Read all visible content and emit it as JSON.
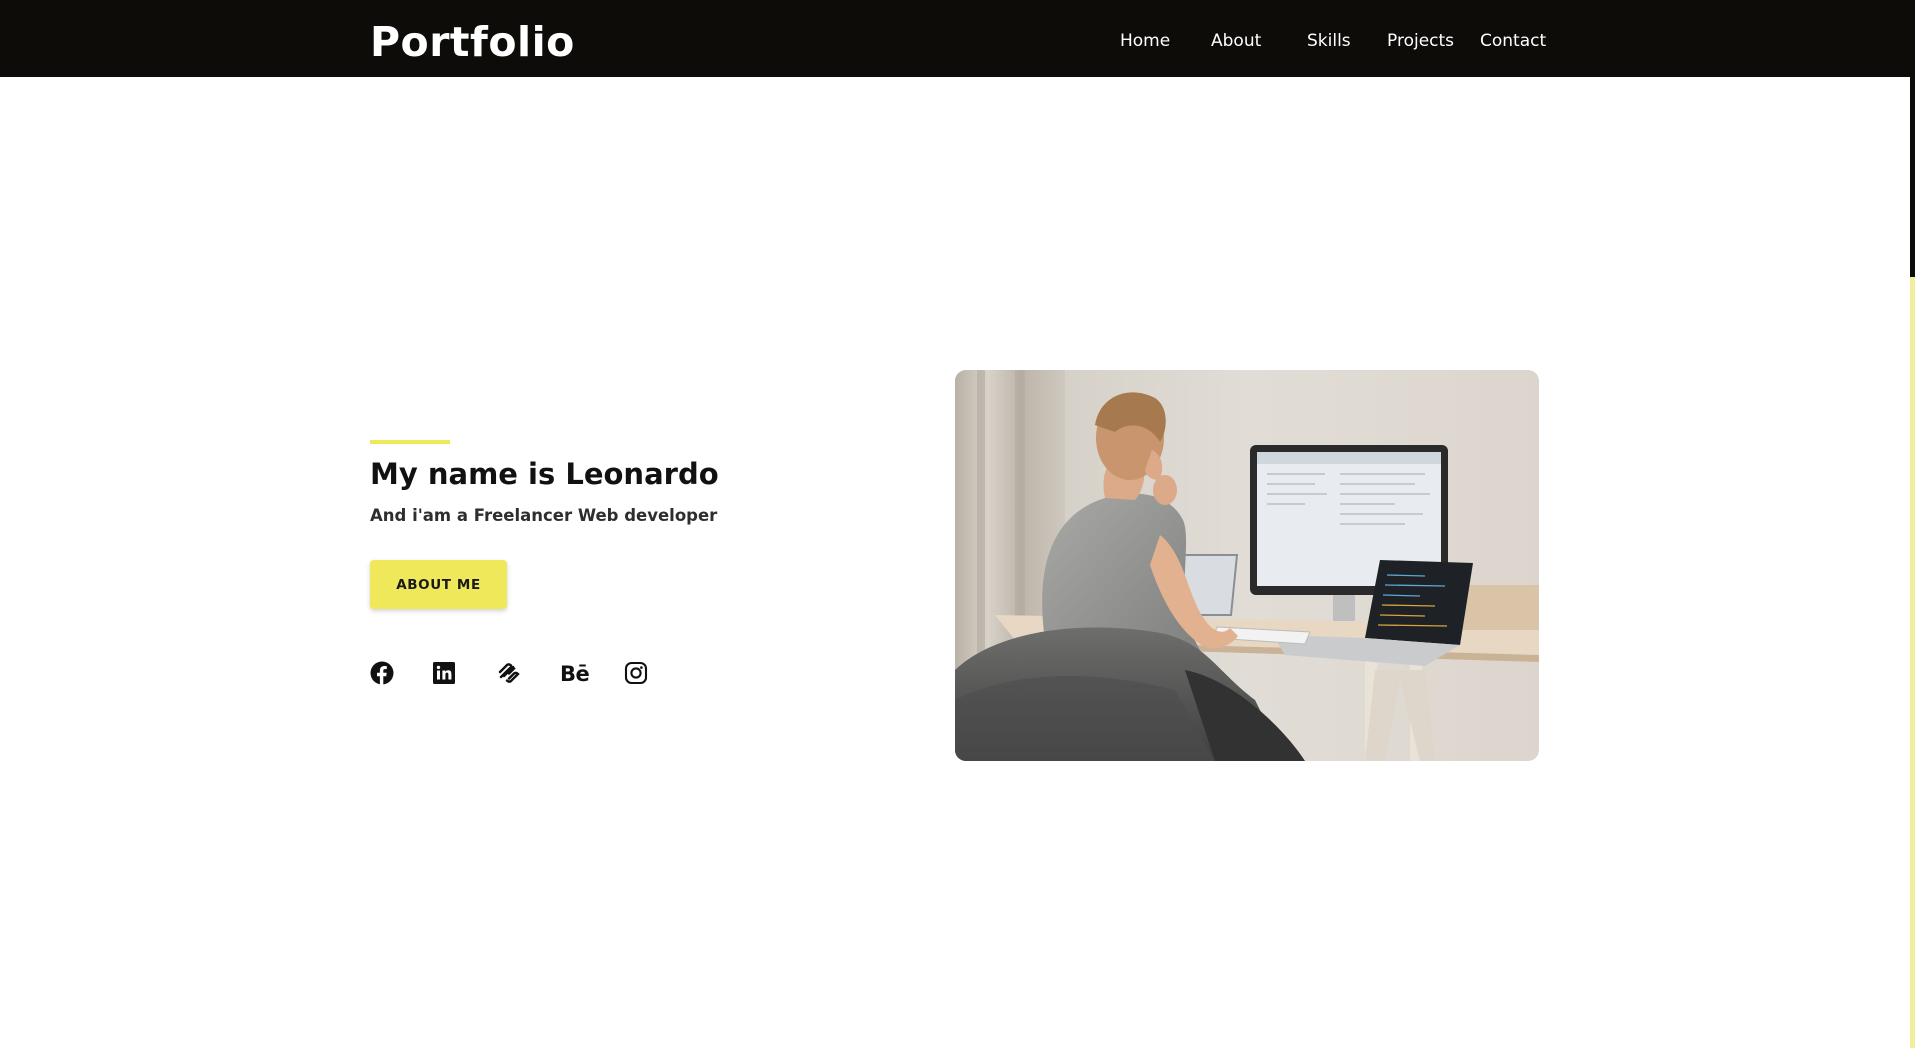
{
  "header": {
    "brand": "Portfolio",
    "nav": [
      "Home",
      "About",
      "Skills",
      "Projects",
      "Contact"
    ]
  },
  "hero": {
    "title": "My name is Leonardo",
    "subtitle": "And i'am a Freelancer Web developer",
    "button_label": "ABOUT ME",
    "photo_subject": "person-working-at-desk-with-computers"
  },
  "social": {
    "icons": [
      "facebook-icon",
      "linkedin-icon",
      "squarespace-icon",
      "behance-icon",
      "instagram-icon"
    ],
    "behance_glyph": "Bē"
  },
  "colors": {
    "header_bg": "#0e0c09",
    "accent": "#efe85a",
    "text": "#111111",
    "page_bg": "#ffffff"
  }
}
